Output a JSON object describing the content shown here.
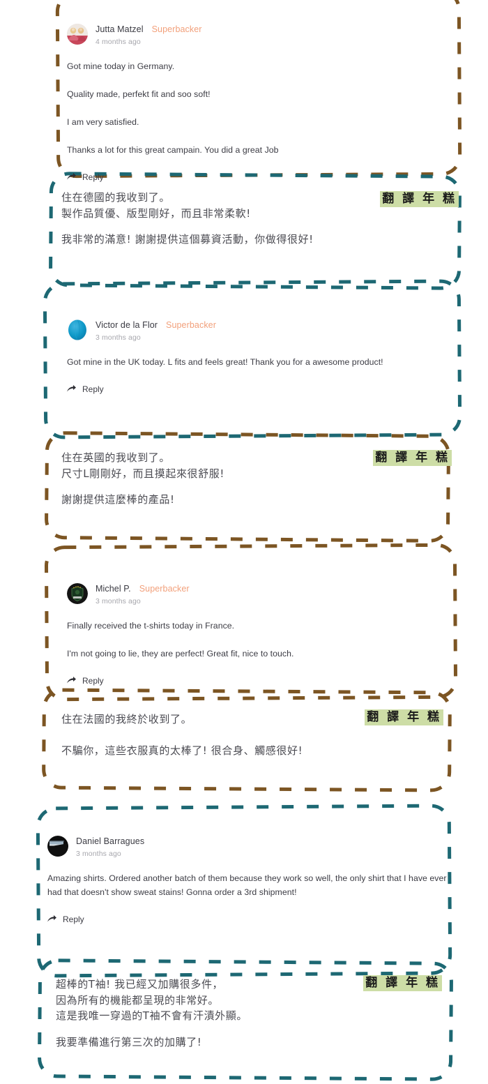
{
  "colors": {
    "brown_dash": "#7c5523",
    "teal_dash": "#1d6873",
    "highlight_green": "#cddda6",
    "superbacker": "#f2a07b",
    "body_text": "#3b3b43",
    "time_text": "#a7a7ad"
  },
  "translate_tag": "翻 譯 年 糕",
  "reply_label": "Reply",
  "comments": [
    {
      "author": "Jutta Matzel",
      "badge": "Superbacker",
      "time": "4 months ago",
      "avatar": "avatar-photo-group",
      "paragraphs": [
        "Got mine today in Germany.",
        "Quality made, perfekt fit and soo soft!",
        "I am very satisfied.",
        "Thanks a lot for this great campain. You did a great Job"
      ]
    },
    {
      "author": "Victor de la Flor",
      "badge": "Superbacker",
      "time": "3 months ago",
      "avatar": "avatar-blue-sphere",
      "paragraphs": [
        "Got mine in the UK today. L fits and feels great! Thank you for a awesome product!"
      ]
    },
    {
      "author": "Michel P.",
      "badge": "Superbacker",
      "time": "3 months ago",
      "avatar": "avatar-dark-shield-badge",
      "paragraphs": [
        "Finally received the t-shirts today in France.",
        "I'm not going to lie, they are perfect! Great fit, nice to touch."
      ]
    },
    {
      "author": "Daniel Barragues",
      "badge": "",
      "time": "3 months ago",
      "avatar": "avatar-dark-photo",
      "paragraphs": [
        "Amazing shirts. Ordered another batch of them because they work so well, the only shirt that I have ever had that doesn't show sweat stains! Gonna order a 3rd shipment!"
      ]
    }
  ],
  "translations": [
    {
      "paragraphs": [
        "住在德國的我收到了。\n製作品質優、版型剛好，而且非常柔軟!",
        "我非常的滿意! 謝謝提供這個募資活動，你做得很好!"
      ]
    },
    {
      "paragraphs": [
        "住在英國的我收到了。\n尺寸L剛剛好，而且摸起來很舒服!",
        "謝謝提供這麼棒的產品!"
      ]
    },
    {
      "paragraphs": [
        "住在法國的我終於收到了。",
        "不騙你，這些衣服真的太棒了! 很合身、觸感很好!"
      ]
    },
    {
      "paragraphs": [
        "超棒的T袖! 我已經又加購很多件，\n因為所有的機能都呈現的非常好。\n這是我唯一穿過的T袖不會有汗漬外顯。",
        "我要準備進行第三次的加購了!"
      ]
    }
  ]
}
